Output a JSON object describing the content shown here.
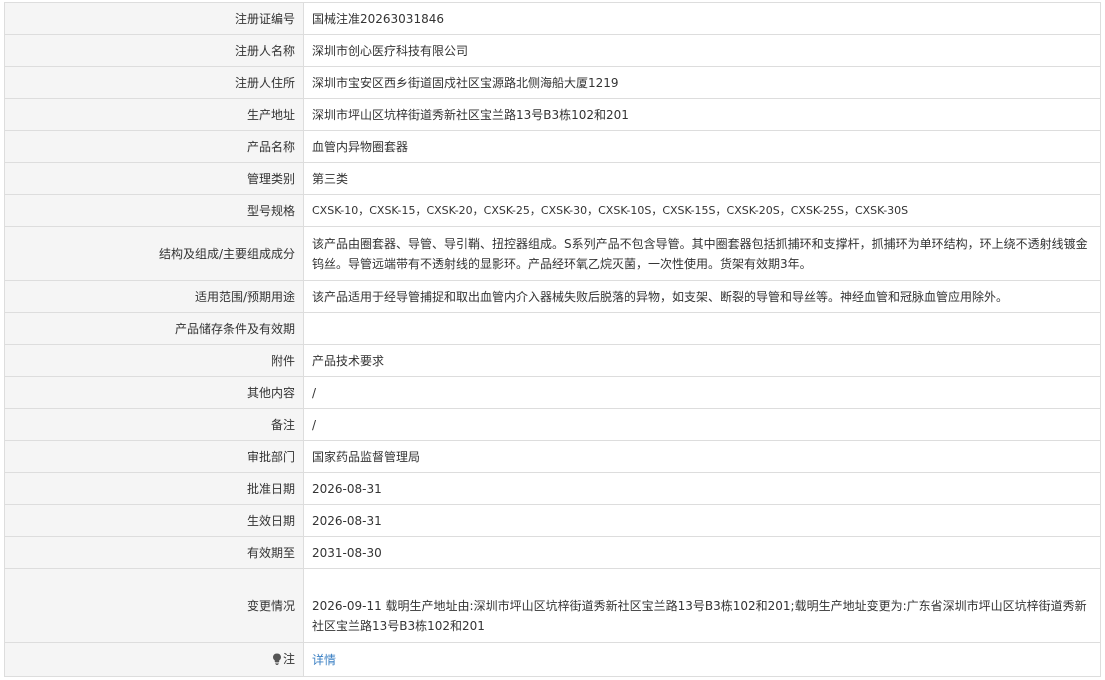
{
  "rows": [
    {
      "label": "注册证编号",
      "value": "国械注准20263031846"
    },
    {
      "label": "注册人名称",
      "value": "深圳市创心医疗科技有限公司"
    },
    {
      "label": "注册人住所",
      "value": "深圳市宝安区西乡街道固戍社区宝源路北侧海船大厦1219"
    },
    {
      "label": "生产地址",
      "value": "深圳市坪山区坑梓街道秀新社区宝兰路13号B3栋102和201"
    },
    {
      "label": "产品名称",
      "value": "血管内异物圈套器"
    },
    {
      "label": "管理类别",
      "value": "第三类"
    },
    {
      "label": "型号规格",
      "value": "CXSK-10，CXSK-15，CXSK-20，CXSK-25，CXSK-30，CXSK-10S，CXSK-15S，CXSK-20S，CXSK-25S，CXSK-30S"
    },
    {
      "label": "结构及组成/主要组成成分",
      "value": "该产品由圈套器、导管、导引鞘、扭控器组成。S系列产品不包含导管。其中圈套器包括抓捕环和支撑杆，抓捕环为单环结构，环上绕不透射线镀金钨丝。导管远端带有不透射线的显影环。产品经环氧乙烷灭菌，一次性使用。货架有效期3年。"
    },
    {
      "label": "适用范围/预期用途",
      "value": "该产品适用于经导管捕捉和取出血管内介入器械失败后脱落的异物，如支架、断裂的导管和导丝等。神经血管和冠脉血管应用除外。"
    },
    {
      "label": "产品储存条件及有效期",
      "value": ""
    },
    {
      "label": "附件",
      "value": "产品技术要求"
    },
    {
      "label": "其他内容",
      "value": "/"
    },
    {
      "label": "备注",
      "value": "/"
    },
    {
      "label": "审批部门",
      "value": "国家药品监督管理局"
    },
    {
      "label": "批准日期",
      "value": "2026-08-31"
    },
    {
      "label": "生效日期",
      "value": "2026-08-31"
    },
    {
      "label": "有效期至",
      "value": "2031-08-30"
    },
    {
      "label": "变更情况",
      "value": "2026-09-11 载明生产地址由:深圳市坪山区坑梓街道秀新社区宝兰路13号B3栋102和201;载明生产地址变更为:广东省深圳市坪山区坑梓街道秀新社区宝兰路13号B3栋102和201"
    }
  ],
  "note": {
    "label": "注",
    "icon": "bulb-icon",
    "link_text": "详情",
    "link_color": "#3a7fc3"
  }
}
